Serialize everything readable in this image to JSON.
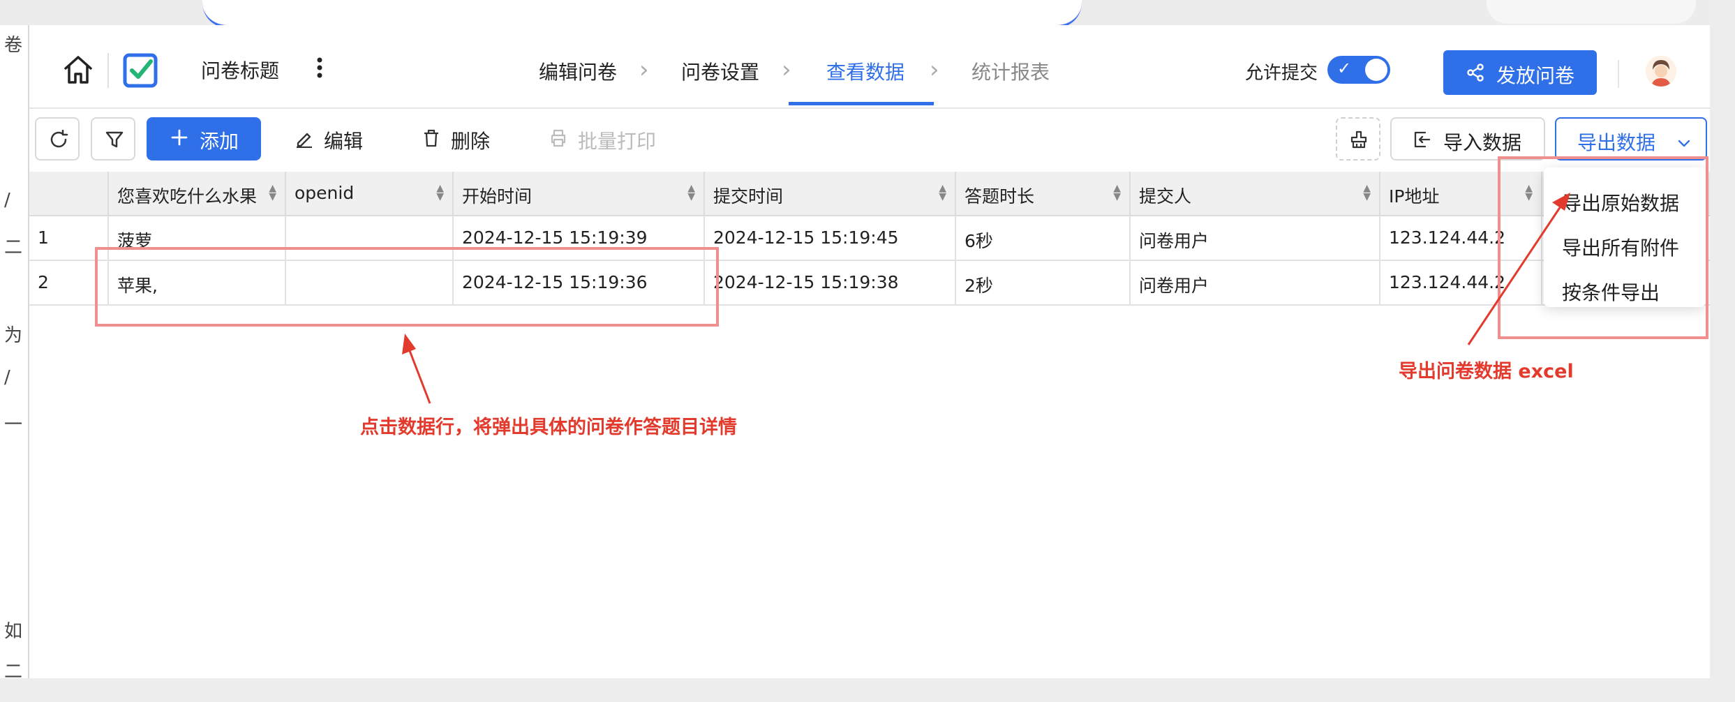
{
  "left_strip": {
    "chars": [
      "卷",
      "/",
      "二",
      "为",
      "/",
      "一",
      "如",
      "二"
    ]
  },
  "header": {
    "doc_title": "问卷标题",
    "steps": [
      {
        "label": "编辑问卷",
        "state": "done"
      },
      {
        "label": "问卷设置",
        "state": "done"
      },
      {
        "label": "查看数据",
        "state": "active"
      },
      {
        "label": "统计报表",
        "state": "todo"
      }
    ],
    "allow_submit_label": "允许提交",
    "allow_submit_on": true,
    "publish_label": "发放问卷"
  },
  "toolbar": {
    "add_label": "添加",
    "edit_label": "编辑",
    "delete_label": "删除",
    "batch_print_label": "批量打印",
    "import_label": "导入数据",
    "export_label": "导出数据"
  },
  "table": {
    "columns": [
      "您喜欢吃什么水果",
      "openid",
      "开始时间",
      "提交时间",
      "答题时长",
      "提交人",
      "IP地址"
    ],
    "rows": [
      [
        "1",
        "菠萝",
        "",
        "2024-12-15 15:19:39",
        "2024-12-15 15:19:45",
        "6秒",
        "问卷用户",
        "123.124.44.2"
      ],
      [
        "2",
        "苹果,",
        "",
        "2024-12-15 15:19:36",
        "2024-12-15 15:19:38",
        "2秒",
        "问卷用户",
        "123.124.44.2"
      ]
    ]
  },
  "export_menu": {
    "items": [
      "导出原始数据",
      "导出所有附件",
      "按条件导出"
    ]
  },
  "annotations": {
    "row_click_note": "点击数据行，将弹出具体的问卷作答题目详情",
    "export_note": "导出问卷数据 excel",
    "color": "#e23b2e"
  },
  "colors": {
    "accent": "#2f6fe8",
    "annotation_box": "#f08f8f"
  }
}
